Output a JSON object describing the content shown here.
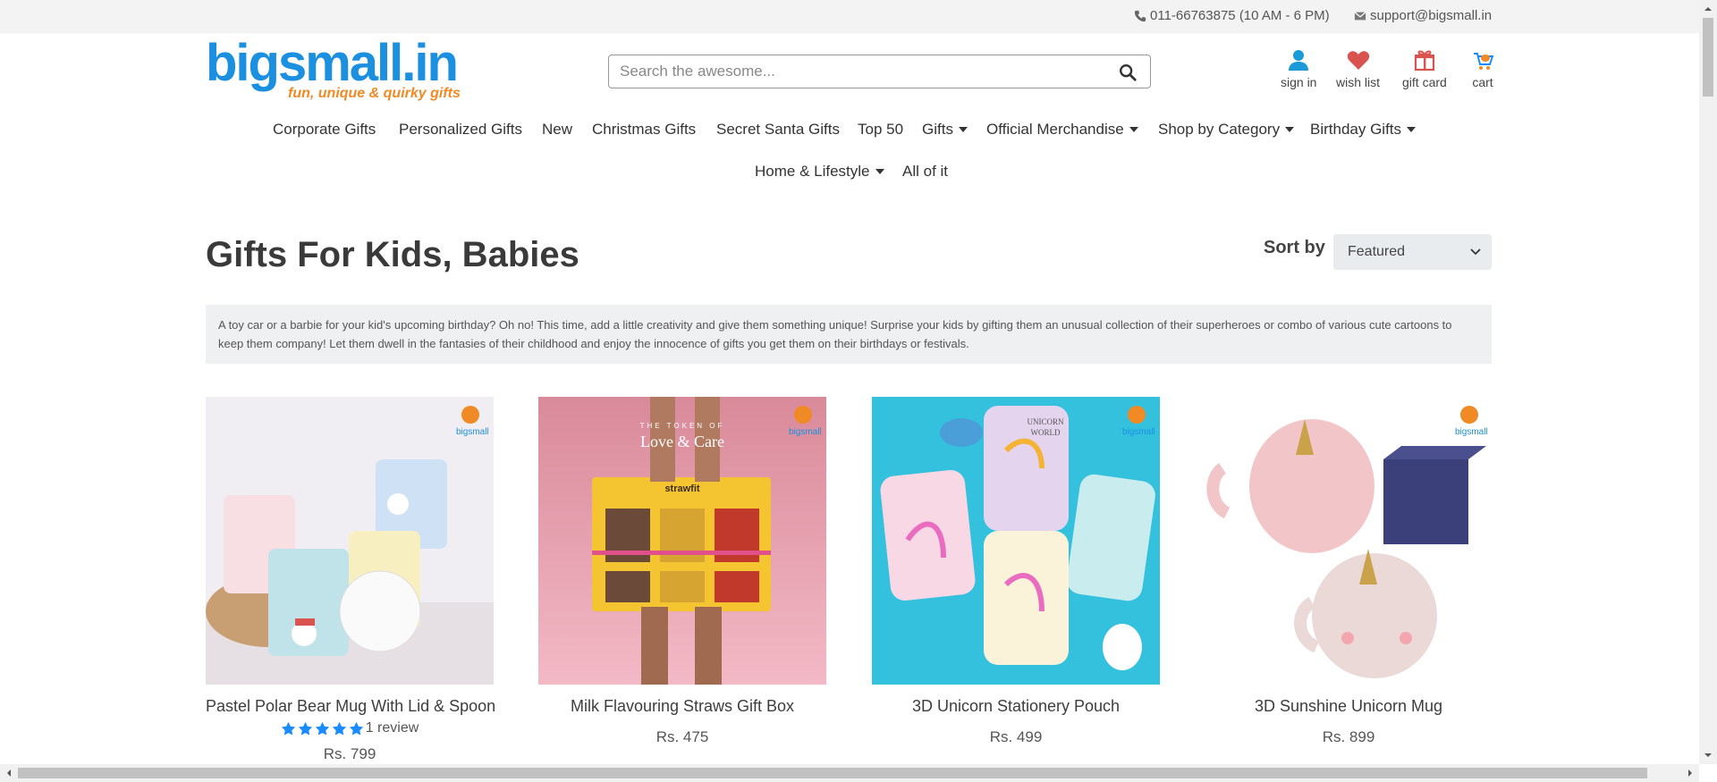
{
  "topbar": {
    "phone": "011-66763875 (10 AM - 6 PM)",
    "email": "support@bigsmall.in"
  },
  "logo": {
    "wordmark": "bigsmall.in",
    "tagline": "fun, unique & quirky gifts"
  },
  "search": {
    "placeholder": "Search the awesome..."
  },
  "header_icons": {
    "sign_in": "sign in",
    "wish_list": "wish list",
    "gift_card": "gift card",
    "cart": "cart"
  },
  "nav": {
    "row1": [
      {
        "label": "Corporate Gifts"
      },
      {
        "label": "Personalized Gifts"
      },
      {
        "label": "New"
      },
      {
        "label": "Christmas Gifts"
      },
      {
        "label": "Secret Santa Gifts"
      },
      {
        "label": "Top 50"
      },
      {
        "label": "Gifts"
      },
      {
        "label": "Official Merchandise"
      },
      {
        "label": "Shop by Category"
      },
      {
        "label": "Birthday Gifts"
      }
    ],
    "row2": [
      {
        "label": "Home & Lifestyle"
      },
      {
        "label": "All of it"
      }
    ]
  },
  "page": {
    "title": "Gifts For Kids, Babies",
    "sort_label": "Sort by",
    "sort_value": "Featured",
    "description": "A toy car or a barbie for your kid's upcoming birthday? Oh no! This time, add a little creativity and give them something unique! Surprise your kids by gifting them an unusual collection of their superheroes or combo of various cute cartoons to keep them company! Let them dwell in the fantasies of their childhood and enjoy the innocence of gifts you get them on their birthdays or festivals."
  },
  "products": [
    {
      "name": "Pastel Polar Bear Mug With Lid & Spoon",
      "rating_stars": 5,
      "reviews": "1 review",
      "price": "Rs. 799"
    },
    {
      "name": "Milk Flavouring Straws Gift Box",
      "price": "Rs. 475",
      "image_text_top": "THE TOKEN OF",
      "image_text_main": "Love & Care",
      "image_brand": "strawfit"
    },
    {
      "name": "3D Unicorn Stationery Pouch",
      "price": "Rs. 499",
      "image_label": "UNICORN WORLD"
    },
    {
      "name": "3D Sunshine Unicorn Mug",
      "price": "Rs. 899"
    }
  ],
  "colors": {
    "brand_blue": "#1b8fe0",
    "brand_orange": "#f08a24",
    "star_blue": "#1a8cff",
    "wish_red": "#d9534f"
  }
}
